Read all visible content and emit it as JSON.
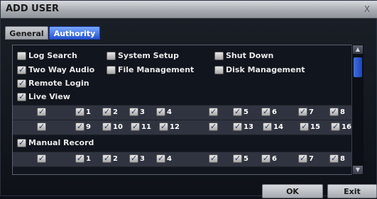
{
  "window": {
    "title": "ADD USER",
    "close_glyph": "X"
  },
  "tabs": [
    {
      "label": "General",
      "active": false
    },
    {
      "label": "Authority",
      "active": true
    }
  ],
  "options_row1": [
    {
      "label": "Log Search",
      "checked": false
    },
    {
      "label": "System Setup",
      "checked": false
    },
    {
      "label": "Shut Down",
      "checked": false
    }
  ],
  "options_row2": [
    {
      "label": "Two Way Audio",
      "checked": true
    },
    {
      "label": "File Management",
      "checked": false
    },
    {
      "label": "Disk Management",
      "checked": false
    }
  ],
  "options_row3": [
    {
      "label": "Remote Login",
      "checked": true
    }
  ],
  "live_view": {
    "label": "Live View",
    "checked": true,
    "row1": [
      {
        "num": "",
        "checked": true
      },
      {
        "num": "1",
        "checked": true
      },
      {
        "num": "2",
        "checked": true
      },
      {
        "num": "3",
        "checked": true
      },
      {
        "num": "4",
        "checked": true
      },
      {
        "num": "",
        "checked": true
      },
      {
        "num": "5",
        "checked": true
      },
      {
        "num": "6",
        "checked": true
      },
      {
        "num": "7",
        "checked": true
      },
      {
        "num": "8",
        "checked": true
      }
    ],
    "row2": [
      {
        "num": "",
        "checked": true
      },
      {
        "num": "9",
        "checked": true
      },
      {
        "num": "10",
        "checked": true
      },
      {
        "num": "11",
        "checked": true
      },
      {
        "num": "12",
        "checked": true
      },
      {
        "num": "",
        "checked": true
      },
      {
        "num": "13",
        "checked": true
      },
      {
        "num": "14",
        "checked": true
      },
      {
        "num": "15",
        "checked": true
      },
      {
        "num": "16",
        "checked": true
      }
    ]
  },
  "manual_record": {
    "label": "Manual Record",
    "checked": true,
    "row1": [
      {
        "num": "",
        "checked": true
      },
      {
        "num": "1",
        "checked": true
      },
      {
        "num": "2",
        "checked": true
      },
      {
        "num": "3",
        "checked": true
      },
      {
        "num": "4",
        "checked": true
      },
      {
        "num": "",
        "checked": true
      },
      {
        "num": "5",
        "checked": true
      },
      {
        "num": "6",
        "checked": true
      },
      {
        "num": "7",
        "checked": true
      },
      {
        "num": "8",
        "checked": true
      }
    ]
  },
  "buttons": {
    "ok": "OK",
    "exit": "Exit"
  },
  "colors": {
    "accent": "#2553cf",
    "titlebar": "#a9adb3",
    "panel": "#11151d"
  }
}
